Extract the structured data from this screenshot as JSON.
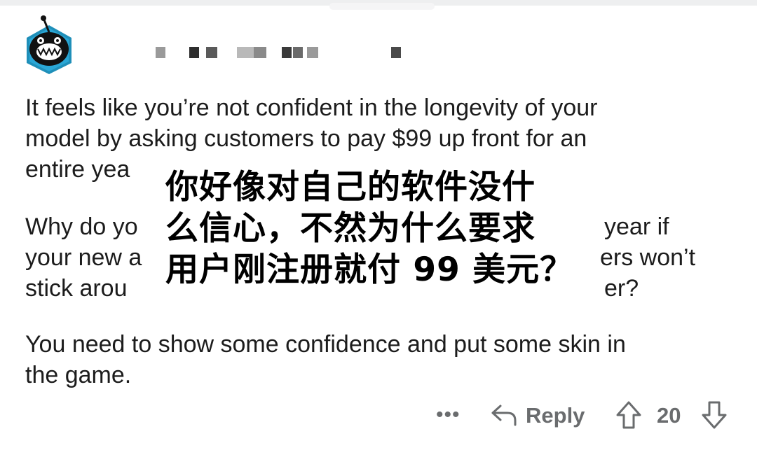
{
  "comment": {
    "paragraph1": {
      "line1": "It feels like you’re not confident in the longevity of your",
      "line2": "model by asking customers to pay $99 up front for an",
      "line3": "entire yea"
    },
    "paragraph2": {
      "line1": "Why do yo",
      "line1b": "year if",
      "line2": "your new a",
      "line2b": "ers won’t",
      "line3": "stick arou",
      "line3b": "er?"
    },
    "paragraph3": {
      "line1": "You need to show some confidence and put some skin in",
      "line2": "the game."
    }
  },
  "overlay_caption": {
    "line1": "你好像对自己的软件没什",
    "line2": "么信心，不然为什么要求",
    "line3": "用户刚注册就付 99 美元？"
  },
  "actions": {
    "more_label": "•••",
    "reply_label": "Reply",
    "score": "20"
  },
  "colors": {
    "text": "#1c1c1c",
    "meta": "#6a6c6e",
    "avatar_ring": "#1f8fb9"
  },
  "icons": [
    "avatar-icon",
    "reply-arrow-icon",
    "upvote-icon",
    "downvote-icon",
    "more-icon"
  ]
}
